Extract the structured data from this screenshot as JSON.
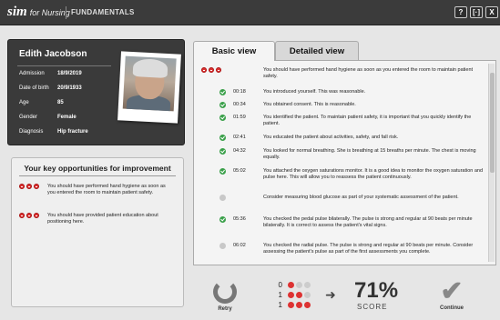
{
  "app": {
    "brand": "sim",
    "brand_sub": "for Nursing",
    "module": "FUNDAMENTALS"
  },
  "window_buttons": [
    "?",
    "[·]",
    "X"
  ],
  "patient": {
    "name": "Edith Jacobson",
    "fields": [
      {
        "label": "Admission",
        "value": "18/9/2019"
      },
      {
        "label": "Date of birth",
        "value": "20/9/1933"
      },
      {
        "label": "Age",
        "value": "85"
      },
      {
        "label": "Gender",
        "value": "Female"
      },
      {
        "label": "Diagnosis",
        "value": "Hip fracture"
      }
    ]
  },
  "opportunities": {
    "title": "Your key opportunities for improvement",
    "items": [
      {
        "text": "You should have performed hand hygiene as soon as you entered the room to maintain patient safety."
      },
      {
        "text": "You should have provided patient education about positioning here."
      }
    ]
  },
  "tabs": {
    "basic": "Basic view",
    "detailed": "Detailed view"
  },
  "events": [
    {
      "status": "missed",
      "time": "",
      "text": "You should have performed hand hygiene as soon as you entered the room to maintain patient safety."
    },
    {
      "status": "ok",
      "time": "00:18",
      "text": "You introduced yourself. This was reasonable."
    },
    {
      "status": "ok",
      "time": "00:34",
      "text": "You obtained consent. This is reasonable."
    },
    {
      "status": "ok",
      "time": "01:59",
      "text": "You identified the patient. To maintain patient safety, it is important that you quickly identify the patient."
    },
    {
      "status": "ok",
      "time": "02:41",
      "text": "You educated the patient about activities, safety, and fall risk."
    },
    {
      "status": "ok",
      "time": "04:32",
      "text": "You looked for normal breathing. She is breathing at 15 breaths per minute. The chest is moving equally."
    },
    {
      "status": "ok",
      "time": "05:02",
      "text": "You attached the oxygen saturations monitor. It is a good idea to monitor the oxygen saturation and pulse here. This will allow you to reassess the patient continuously."
    },
    {
      "status": "neutral",
      "time": "",
      "text": "Consider measuring blood glucose as part of your systematic assessment of the patient."
    },
    {
      "status": "ok",
      "time": "05:36",
      "text": "You checked the pedal pulse bilaterally. The pulse is strong and regular at 90 beats per minute bilaterally. It is correct to assess the patient's vital signs."
    },
    {
      "status": "neutral",
      "time": "06:02",
      "text": "You checked the radial pulse. The pulse is strong and regular at 90 beats per minute. Consider assessing the patient's pulse as part of the first assessments you complete."
    }
  ],
  "score": {
    "rows": [
      {
        "count": "0",
        "red": 1,
        "grey": 2
      },
      {
        "count": "1",
        "red": 2,
        "grey": 1
      },
      {
        "count": "1",
        "red": 3,
        "grey": 0
      }
    ],
    "percent": "71%",
    "label": "SCORE"
  },
  "actions": {
    "retry": "Retry",
    "continue": "Continue"
  },
  "colors": {
    "accent_red": "#d33333",
    "ok_green": "#3aa04a",
    "panel_dark": "#3a3a3a"
  }
}
